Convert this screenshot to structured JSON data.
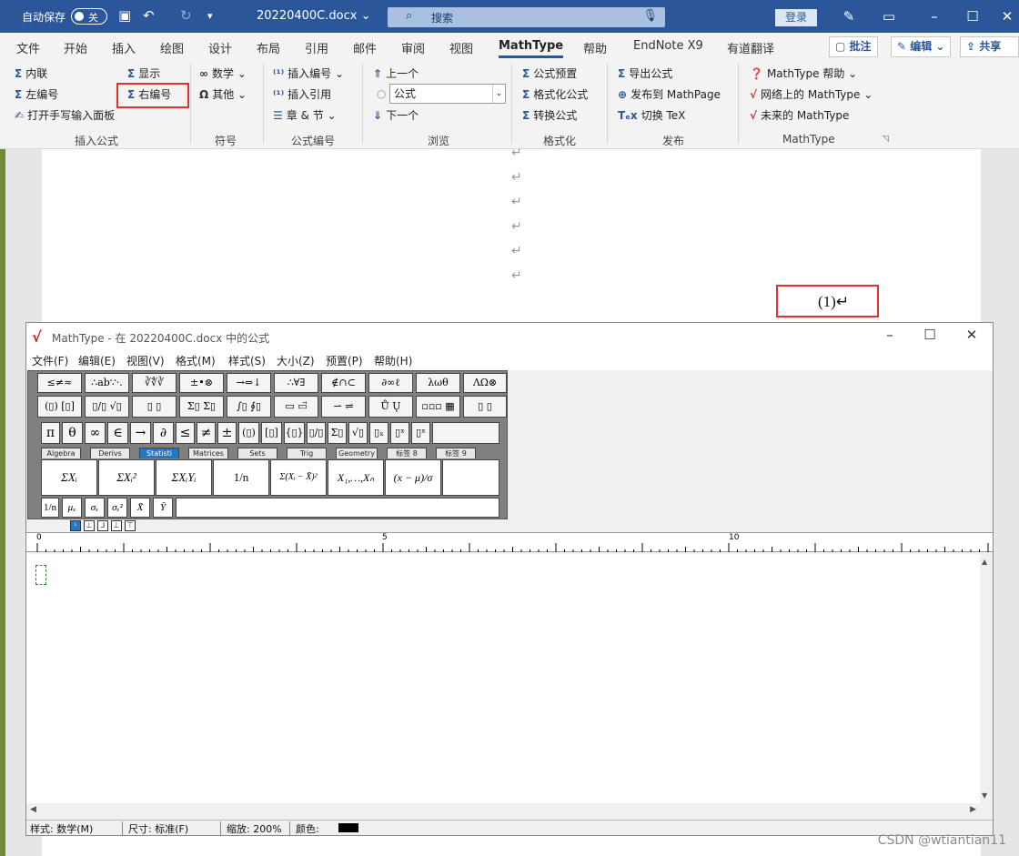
{
  "titlebar": {
    "autosave": "自动保存",
    "toggle": "关",
    "doc_title": "20220400C.docx",
    "search_placeholder": "搜索",
    "login": "登录"
  },
  "tabs": [
    "文件",
    "开始",
    "插入",
    "绘图",
    "设计",
    "布局",
    "引用",
    "邮件",
    "审阅",
    "视图",
    "MathType",
    "帮助",
    "EndNote X9",
    "有道翻译"
  ],
  "active_tab": "MathType",
  "tab_right": {
    "comment": "批注",
    "edit": "编辑",
    "share": "共享"
  },
  "ribbon": {
    "insert_formula": {
      "inline": "内联",
      "display": "显示",
      "left_num": "左编号",
      "right_num": "右编号",
      "handwrite": "打开手写输入面板",
      "group": "插入公式"
    },
    "symbols": {
      "math": "数学",
      "other": "其他",
      "group": "符号"
    },
    "numbering": {
      "insert_num": "插入编号",
      "insert_ref": "插入引用",
      "chapter": "章 & 节",
      "group": "公式编号"
    },
    "browse": {
      "prev": "上一个",
      "combo": "公式",
      "next": "下一个",
      "group": "浏览"
    },
    "format": {
      "preset": "公式预置",
      "format": "格式化公式",
      "convert": "转换公式",
      "group": "格式化"
    },
    "publish": {
      "export": "导出公式",
      "mathpage": "发布到 MathPage",
      "tex": "切换 TeX",
      "group": "发布"
    },
    "mathtype": {
      "help": "MathType 帮助",
      "online": "网络上的 MathType",
      "future": "未来的 MathType",
      "group": "MathType"
    }
  },
  "document": {
    "para_mark": "↵",
    "equation_number": "(1)↵"
  },
  "mathtype": {
    "title": "MathType - 在 20220400C.docx 中的公式",
    "menu": [
      "文件(F)",
      "编辑(E)",
      "视图(V)",
      "格式(M)",
      "样式(S)",
      "大小(Z)",
      "预置(P)",
      "帮助(H)"
    ],
    "row1": [
      "≤≠≈",
      "∴ab∵·.",
      "∛∜∛",
      "±•⊗",
      "→⇔↓",
      "∴∀∃",
      "∉∩⊂",
      "∂∞ℓ",
      "λωθ",
      "ΛΩ⊗"
    ],
    "row2": [
      "(▯) [▯]",
      "▯/▯ √▯",
      "▯ ▯",
      "Σ▯ Σ▯",
      "∫▯ ∮▯",
      "▭ ▭⃗",
      "⇀ ⇌",
      "Ů Ų",
      "▫▫▫ ▦",
      "▯ ▯"
    ],
    "row3": [
      "π",
      "θ",
      "∞",
      "∈",
      "→",
      "∂",
      "≤",
      "≠",
      "±",
      "(▯)",
      "[▯]",
      "{▯}",
      "▯/▯",
      "Σ▯",
      "√▯",
      "▯ₓ",
      "▯ˣ",
      "▯ˣ"
    ],
    "palette_tabs": [
      "Algebra",
      "Derivs",
      "Statisti",
      "Matrices",
      "Sets",
      "Trig",
      "Geometry",
      "标签 8",
      "标签 9"
    ],
    "selected_tab": "Statisti",
    "templates": [
      "ΣXᵢ",
      "ΣXᵢ²",
      "ΣXᵢYᵢ",
      "1/n",
      "Σ(Xᵢ − X̄)²",
      "X₁,…,Xₙ",
      "(x − μ)/σ"
    ],
    "small": [
      "1/n",
      "μₓ",
      "σₓ",
      "σₓ²",
      "X̄",
      "Ȳ"
    ],
    "ruler_nums": [
      "0",
      "5",
      "10"
    ],
    "status": {
      "style": "样式: 数学(M)",
      "size": "尺寸: 标准(F)",
      "zoom": "缩放: 200%",
      "color": "颜色:"
    }
  },
  "watermark": "CSDN @wtiantian11"
}
